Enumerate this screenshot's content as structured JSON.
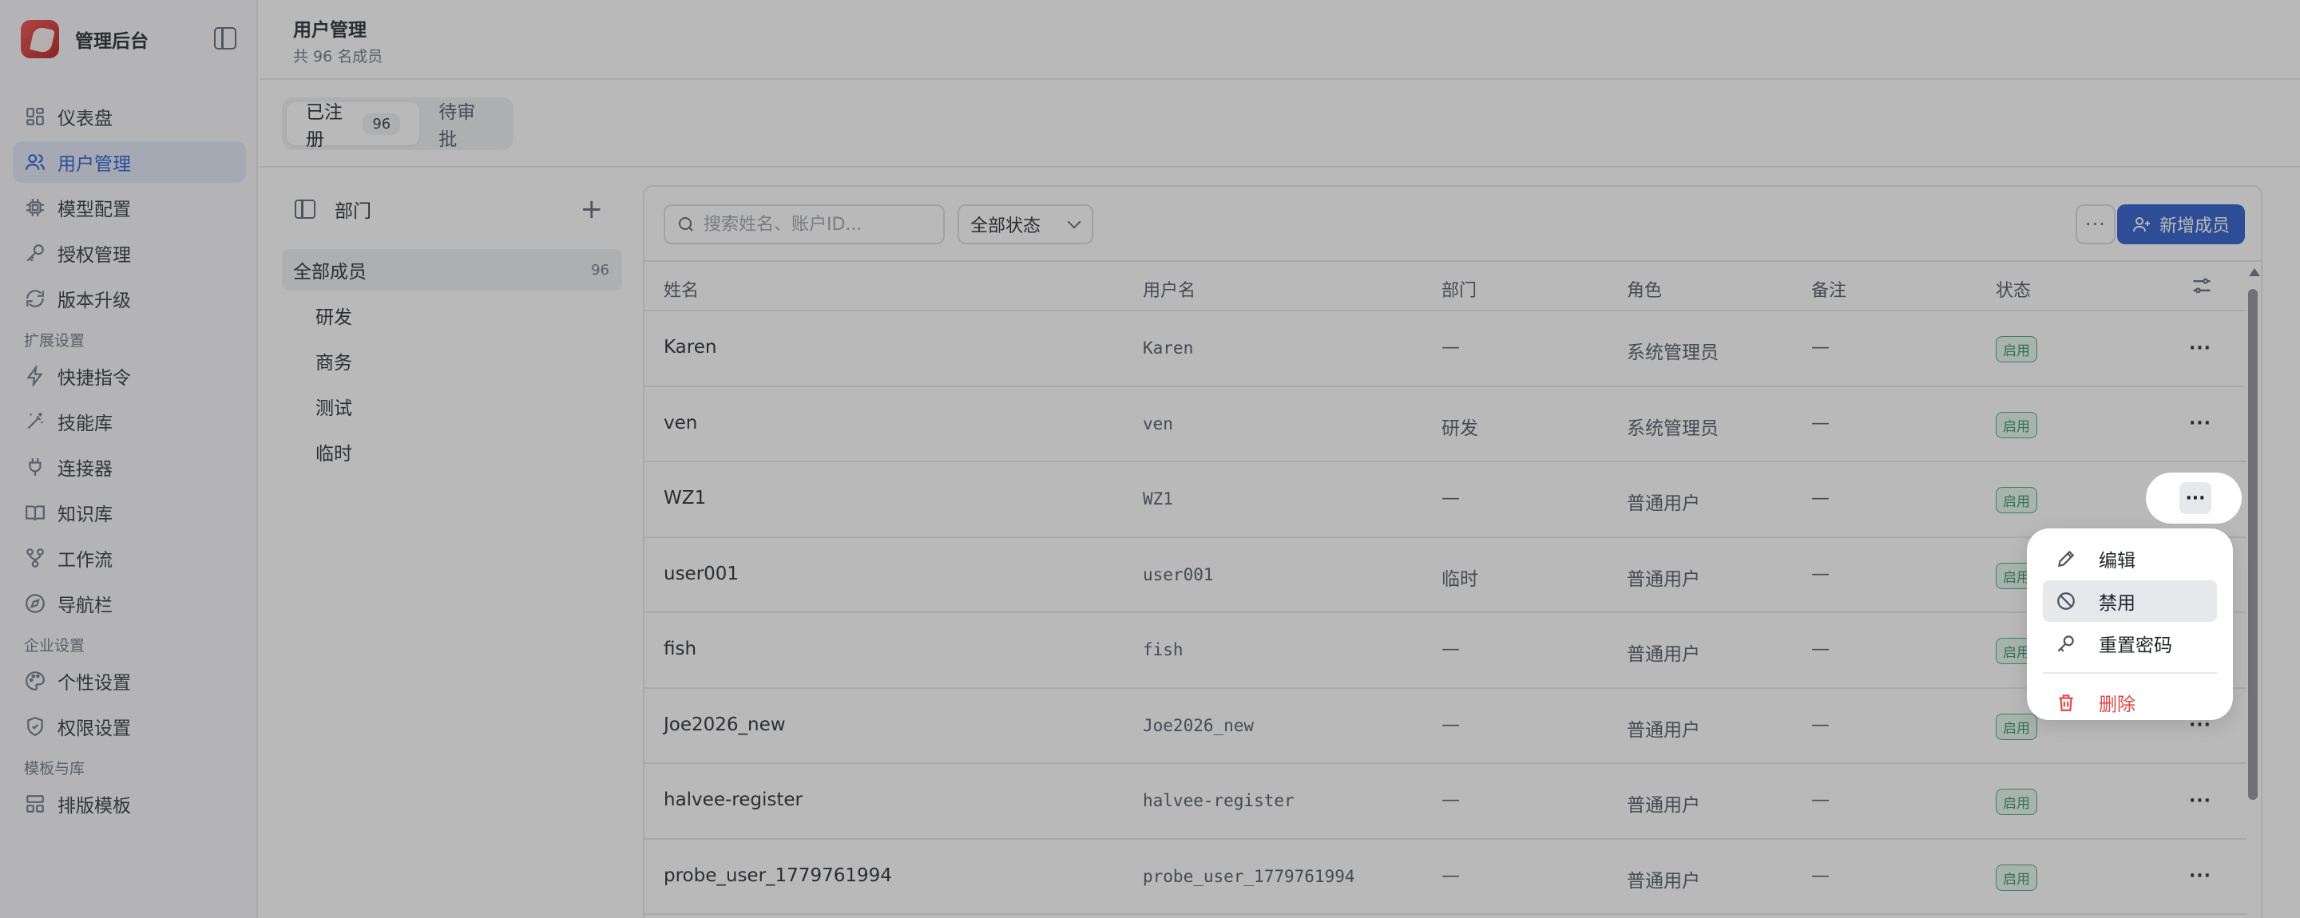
{
  "app": {
    "title": "管理后台"
  },
  "sidebar": {
    "items": [
      {
        "label": "仪表盘",
        "icon": "dashboard-icon"
      },
      {
        "label": "用户管理",
        "icon": "users-icon",
        "active": true
      },
      {
        "label": "模型配置",
        "icon": "chip-icon"
      },
      {
        "label": "授权管理",
        "icon": "key-icon"
      },
      {
        "label": "版本升级",
        "icon": "refresh-icon"
      }
    ],
    "section_ext": "扩展设置",
    "ext_items": [
      {
        "label": "快捷指令",
        "icon": "lightning-icon"
      },
      {
        "label": "技能库",
        "icon": "wand-icon"
      },
      {
        "label": "连接器",
        "icon": "plug-icon"
      },
      {
        "label": "知识库",
        "icon": "book-icon"
      },
      {
        "label": "工作流",
        "icon": "workflow-icon"
      },
      {
        "label": "导航栏",
        "icon": "compass-icon"
      }
    ],
    "section_enterprise": "企业设置",
    "enterprise_items": [
      {
        "label": "个性设置",
        "icon": "palette-icon"
      },
      {
        "label": "权限设置",
        "icon": "shield-icon"
      }
    ],
    "section_templates": "模板与库",
    "template_items": [
      {
        "label": "排版模板",
        "icon": "layout-icon"
      }
    ]
  },
  "header": {
    "title": "用户管理",
    "subtitle": "共 96 名成员"
  },
  "tabs": [
    {
      "label": "已注册",
      "count": "96",
      "active": true
    },
    {
      "label": "待审批"
    }
  ],
  "departments": {
    "title": "部门",
    "items": [
      {
        "label": "全部成员",
        "count": "96",
        "active": true
      },
      {
        "label": "研发"
      },
      {
        "label": "商务"
      },
      {
        "label": "测试"
      },
      {
        "label": "临时"
      }
    ]
  },
  "toolbar": {
    "search_placeholder": "搜索姓名、账户ID...",
    "status_filter": "全部状态",
    "more_label": "···",
    "add_label": "新增成员"
  },
  "table": {
    "columns": [
      "姓名",
      "用户名",
      "部门",
      "角色",
      "备注",
      "状态"
    ],
    "rows": [
      {
        "name": "Karen",
        "username": "Karen",
        "dept": "—",
        "role": "系统管理员",
        "note": "—",
        "status": "启用"
      },
      {
        "name": "ven",
        "username": "ven",
        "dept": "研发",
        "role": "系统管理员",
        "note": "—",
        "status": "启用"
      },
      {
        "name": "WZ1",
        "username": "WZ1",
        "dept": "—",
        "role": "普通用户",
        "note": "—",
        "status": "启用"
      },
      {
        "name": "user001",
        "username": "user001",
        "dept": "临时",
        "role": "普通用户",
        "note": "—",
        "status": "启用"
      },
      {
        "name": "fish",
        "username": "fish",
        "dept": "—",
        "role": "普通用户",
        "note": "—",
        "status": "启用"
      },
      {
        "name": "Joe2026_new",
        "username": "Joe2026_new",
        "dept": "—",
        "role": "普通用户",
        "note": "—",
        "status": "启用"
      },
      {
        "name": "halvee-register",
        "username": "halvee-register",
        "dept": "—",
        "role": "普通用户",
        "note": "—",
        "status": "启用"
      },
      {
        "name": "probe_user_1779761994",
        "username": "probe_user_1779761994",
        "dept": "—",
        "role": "普通用户",
        "note": "—",
        "status": "启用"
      }
    ],
    "row_more": "···"
  },
  "row_menu": {
    "items": [
      {
        "label": "编辑",
        "icon": "pencil-icon"
      },
      {
        "label": "禁用",
        "icon": "ban-icon"
      },
      {
        "label": "重置密码",
        "icon": "key-icon"
      },
      {
        "label": "删除",
        "icon": "trash-icon"
      }
    ]
  },
  "colors": {
    "accent": "#2456c8",
    "status_green": "#2b8f60",
    "danger": "#e04848",
    "brand_red": "#d42a2a"
  }
}
